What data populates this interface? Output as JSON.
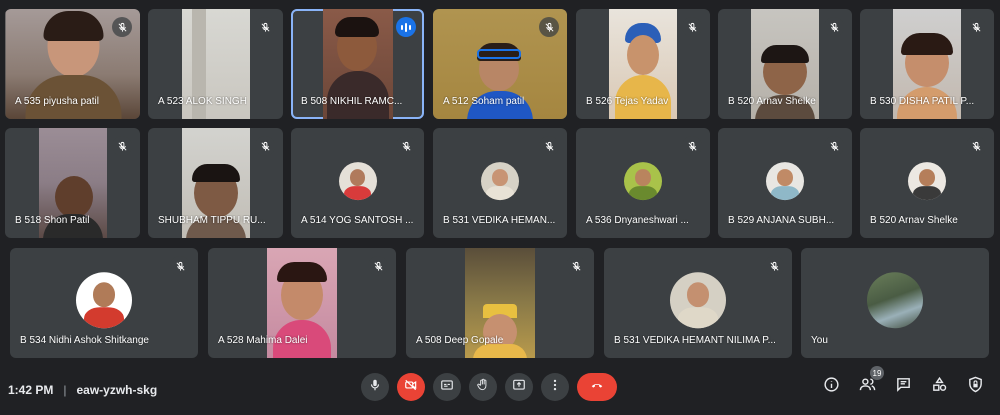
{
  "meeting": {
    "time": "1:42 PM",
    "separator": "|",
    "code": "eaw-yzwh-skg"
  },
  "participants": [
    {
      "name": "A 535 piyusha patil",
      "muted": true
    },
    {
      "name": "A 523 ALOK SINGH",
      "muted": true
    },
    {
      "name": "B 508 NIKHIL RAMC...",
      "muted": false,
      "speaking": true
    },
    {
      "name": "A 512 Soham patil",
      "muted": true
    },
    {
      "name": "B 526 Tejas Yadav",
      "muted": true
    },
    {
      "name": "B 520 Arnav Shelke",
      "muted": true
    },
    {
      "name": "B 530 DISHA PATIL P...",
      "muted": true
    },
    {
      "name": "B 518 Shon Patil",
      "muted": true
    },
    {
      "name": "SHUBHAM TIPPU RU...",
      "muted": true
    },
    {
      "name": "A 514 YOG SANTOSH ...",
      "muted": true
    },
    {
      "name": "B 531 VEDIKA HEMAN...",
      "muted": true
    },
    {
      "name": "A 536 Dnyaneshwari ...",
      "muted": true
    },
    {
      "name": "B 529 ANJANA SUBH...",
      "muted": true
    },
    {
      "name": "B 520 Arnav Shelke",
      "muted": true
    },
    {
      "name": "B 534 Nidhi Ashok Shitkange",
      "muted": true
    },
    {
      "name": "A 528 Mahima Dalei",
      "muted": true
    },
    {
      "name": "A 508 Deep Gopale",
      "muted": true
    },
    {
      "name": "B 531 VEDIKA HEMANT NILIMA P...",
      "muted": true
    },
    {
      "name": "You",
      "muted": false
    }
  ],
  "controls": {
    "mic_icon": "mic-icon",
    "camera_icon": "camera-off-icon",
    "captions_icon": "captions-icon",
    "raise_hand_icon": "hand-icon",
    "present_icon": "present-icon",
    "more_icon": "more-vert-icon",
    "end_call_icon": "end-call-icon"
  },
  "right_controls": {
    "participant_count": "19"
  },
  "colors": {
    "background": "#202124",
    "tile": "#3c4043",
    "end_call": "#ea4335",
    "speaking": "#1a73e8"
  }
}
